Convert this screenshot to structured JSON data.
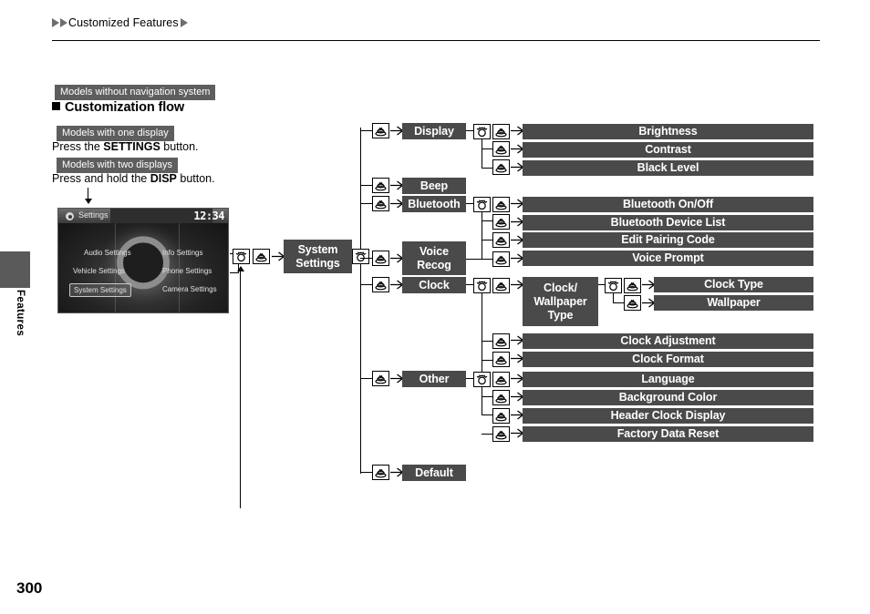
{
  "header": {
    "breadcrumb": "Customized Features",
    "left_arrows": 2,
    "right_arrows": 1
  },
  "sidebar": {
    "tab_label": "Features",
    "page_number": "300"
  },
  "intro": {
    "models_badge": "Models without navigation system",
    "section_title": "Customization flow",
    "one_display_badge": "Models with one display",
    "one_display_text_pre": "Press the ",
    "one_display_text_bold": "SETTINGS",
    "one_display_text_post": " button.",
    "two_display_badge": "Models with two displays",
    "two_display_text_pre": "Press and hold the ",
    "two_display_text_bold": "DISP",
    "two_display_text_post": " button."
  },
  "device": {
    "title": "Settings",
    "clock": "12:34",
    "buttons": [
      "Audio Settings",
      "Info Settings",
      "Vehicle Settings",
      "Phone Settings",
      "System Settings",
      "Camera Settings"
    ],
    "selected": "System Settings"
  },
  "icons": {
    "rotate": "rotate-dial-icon",
    "press": "press-button-icon",
    "arrow": "arrow-right-icon"
  },
  "colors": {
    "box": "#4a4a4a",
    "badge": "#5e5e5e",
    "tab": "#5a5a5a"
  },
  "flow": {
    "root": "System Settings",
    "branches": [
      {
        "label": "Display",
        "children": [
          "Brightness",
          "Contrast",
          "Black Level"
        ]
      },
      {
        "label": "Beep",
        "children": []
      },
      {
        "label": "Bluetooth",
        "children": [
          "Bluetooth On/Off",
          "Bluetooth Device List",
          "Edit Pairing Code"
        ]
      },
      {
        "label": "Voice Recog",
        "children": [
          "Voice Prompt"
        ]
      },
      {
        "label": "Clock",
        "children": [
          "Clock/ Wallpaper Type",
          "Clock Adjustment",
          "Clock Format"
        ]
      },
      {
        "label": "Other",
        "children": [
          "Language",
          "Background Color",
          "Header Clock Display",
          "Factory Data Reset"
        ]
      },
      {
        "label": "Default",
        "children": []
      }
    ],
    "labels": {
      "display": "Display",
      "beep": "Beep",
      "bluetooth": "Bluetooth",
      "voice_recog_l1": "Voice",
      "voice_recog_l2": "Recog",
      "clock": "Clock",
      "other": "Other",
      "default": "Default",
      "system_settings_l1": "System",
      "system_settings_l2": "Settings",
      "brightness": "Brightness",
      "contrast": "Contrast",
      "black_level": "Black Level",
      "bt_onoff": "Bluetooth On/Off",
      "bt_device_list": "Bluetooth Device List",
      "bt_edit_pairing": "Edit Pairing Code",
      "voice_prompt": "Voice Prompt",
      "cw_type_l1": "Clock/",
      "cw_type_l2": "Wallpaper",
      "cw_type_l3": "Type",
      "clock_type": "Clock Type",
      "wallpaper": "Wallpaper",
      "clock_adjustment": "Clock Adjustment",
      "clock_format": "Clock Format",
      "language": "Language",
      "background_color": "Background Color",
      "header_clock_display": "Header Clock Display",
      "factory_data_reset": "Factory Data Reset"
    }
  }
}
